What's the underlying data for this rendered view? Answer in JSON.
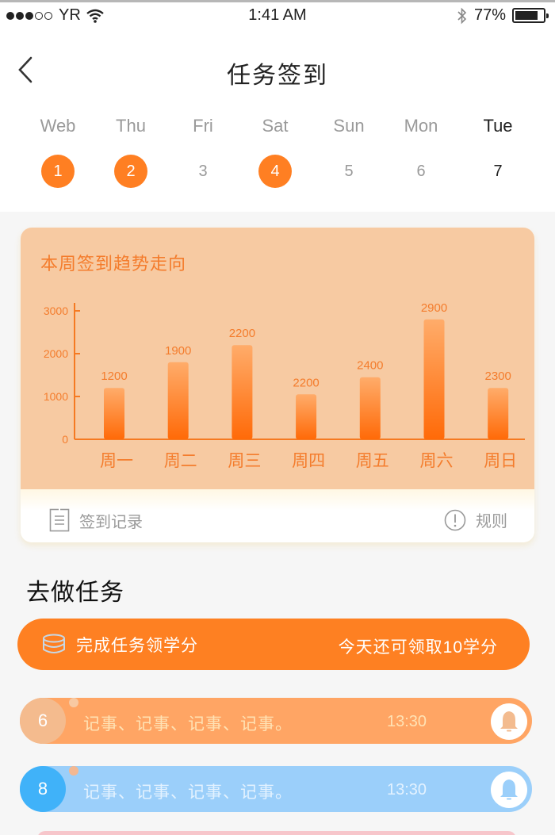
{
  "status_bar": {
    "carrier": "YR",
    "signal_strength": "3 of 5",
    "time": "1:41 AM",
    "battery_percent": "77%",
    "battery_level": 0.77,
    "icons": [
      "signal-dots-icon",
      "wifi-icon",
      "bluetooth-icon",
      "battery-icon"
    ]
  },
  "nav": {
    "back_icon": "chevron-left-icon",
    "title": "任务签到"
  },
  "week": {
    "days": [
      {
        "name": "Web",
        "number": "1",
        "checked": true,
        "today": false
      },
      {
        "name": "Thu",
        "number": "2",
        "checked": true,
        "today": false
      },
      {
        "name": "Fri",
        "number": "3",
        "checked": false,
        "today": false
      },
      {
        "name": "Sat",
        "number": "4",
        "checked": true,
        "today": false
      },
      {
        "name": "Sun",
        "number": "5",
        "checked": false,
        "today": false
      },
      {
        "name": "Mon",
        "number": "6",
        "checked": false,
        "today": false
      },
      {
        "name": "Tue",
        "number": "7",
        "checked": false,
        "today": true
      }
    ]
  },
  "trend_card": {
    "title": "本周签到趋势走向",
    "footer": {
      "records_label": "签到记录",
      "records_icon": "document-list-icon",
      "rules_label": "规则",
      "rules_icon": "exclamation-circle-icon"
    }
  },
  "chart_data": {
    "type": "bar",
    "title": "本周签到趋势走向",
    "xlabel": "",
    "ylabel": "",
    "categories": [
      "周一",
      "周二",
      "周三",
      "周四",
      "周五",
      "周六",
      "周日"
    ],
    "values": [
      1200,
      1900,
      2200,
      2200,
      2400,
      2900,
      2300
    ],
    "drawn_bar_values": [
      1200,
      1800,
      2200,
      1050,
      1450,
      2800,
      1200
    ],
    "y_ticks": [
      0,
      1000,
      2000,
      3000
    ],
    "ylim": [
      0,
      3200
    ],
    "grid": false,
    "legend": "none",
    "colors": {
      "bar_top": "#ffac6a",
      "bar_bottom": "#ff6a08",
      "axis": "#f57a22",
      "label": "#f47c2c"
    }
  },
  "tasks_section": {
    "title": "去做任务",
    "banner": {
      "icon": "coins-stack-icon",
      "left_label": "完成任务领学分",
      "right_label": "今天还可领取10学分"
    },
    "items": [
      {
        "badge": "6",
        "text": "记事、记事、记事、记事。",
        "time": "13:30",
        "icon": "bell-icon",
        "color": "#ffa564"
      },
      {
        "badge": "8",
        "text": "记事、记事、记事、记事。",
        "time": "13:30",
        "icon": "bell-icon",
        "color": "#9bcffa"
      }
    ]
  },
  "colors": {
    "accent": "#ff7f22",
    "card_bg": "#f7caa2",
    "page_bg": "#f6f6f6"
  }
}
